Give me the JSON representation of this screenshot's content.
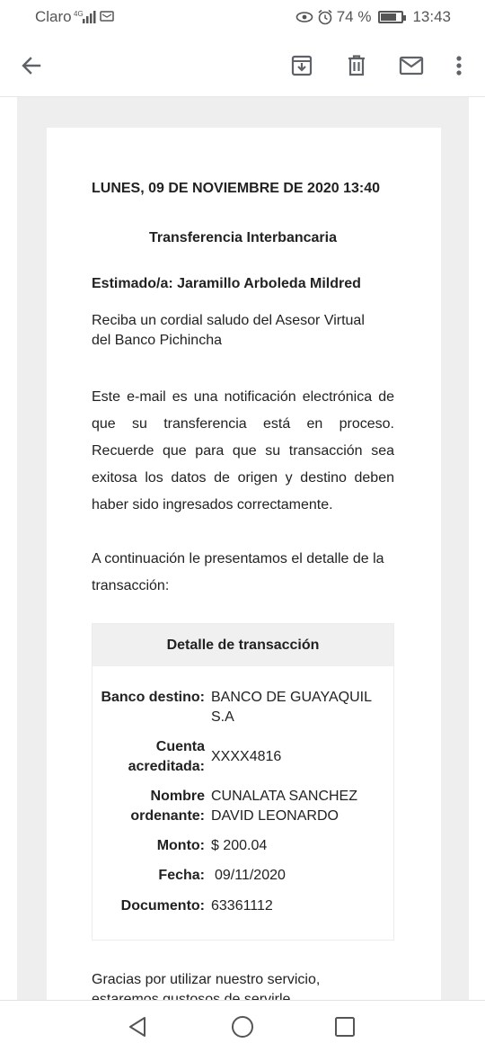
{
  "status_bar": {
    "carrier": "Claro",
    "battery": "74 %",
    "time": "13:43"
  },
  "app_bar": {
    "icons": [
      "back-arrow-icon",
      "archive-icon",
      "delete-icon",
      "mail-icon",
      "more-vert-icon"
    ]
  },
  "email": {
    "date": "LUNES, 09 DE NOVIEMBRE DE 2020 13:40",
    "subject": "Transferencia Interbancaria",
    "greeting": "Estimado/a: Jaramillo Arboleda Mildred",
    "intro": "Reciba un cordial saludo del Asesor Virtual del Banco Pichincha",
    "notice": "Este e-mail es una notificación electrónica de que su transferencia está en proceso. Recuerde que para que su transacción sea exitosa los datos de origen y destino deben haber sido ingresados correctamente.",
    "detail_intro": "A continuación le presentamos el detalle de la transacción:",
    "detail": {
      "title": "Detalle de transacción",
      "rows": [
        {
          "label": "Banco destino:",
          "value": "BANCO DE GUAYAQUIL S.A"
        },
        {
          "label": "Cuenta acreditada:",
          "value": "XXXX4816"
        },
        {
          "label": "Nombre ordenante:",
          "value": "CUNALATA SANCHEZ DAVID LEONARDO"
        },
        {
          "label": "Monto:",
          "value": "$ 200.04"
        },
        {
          "label": "Fecha:",
          "value": "09/11/2020"
        },
        {
          "label": "Documento:",
          "value": "63361112"
        }
      ]
    },
    "closing": "Gracias por utilizar nuestro servicio, estaremos gustosos de servirle."
  },
  "nav_bar": {
    "icons": [
      "nav-back-icon",
      "nav-home-icon",
      "nav-recents-icon"
    ]
  }
}
